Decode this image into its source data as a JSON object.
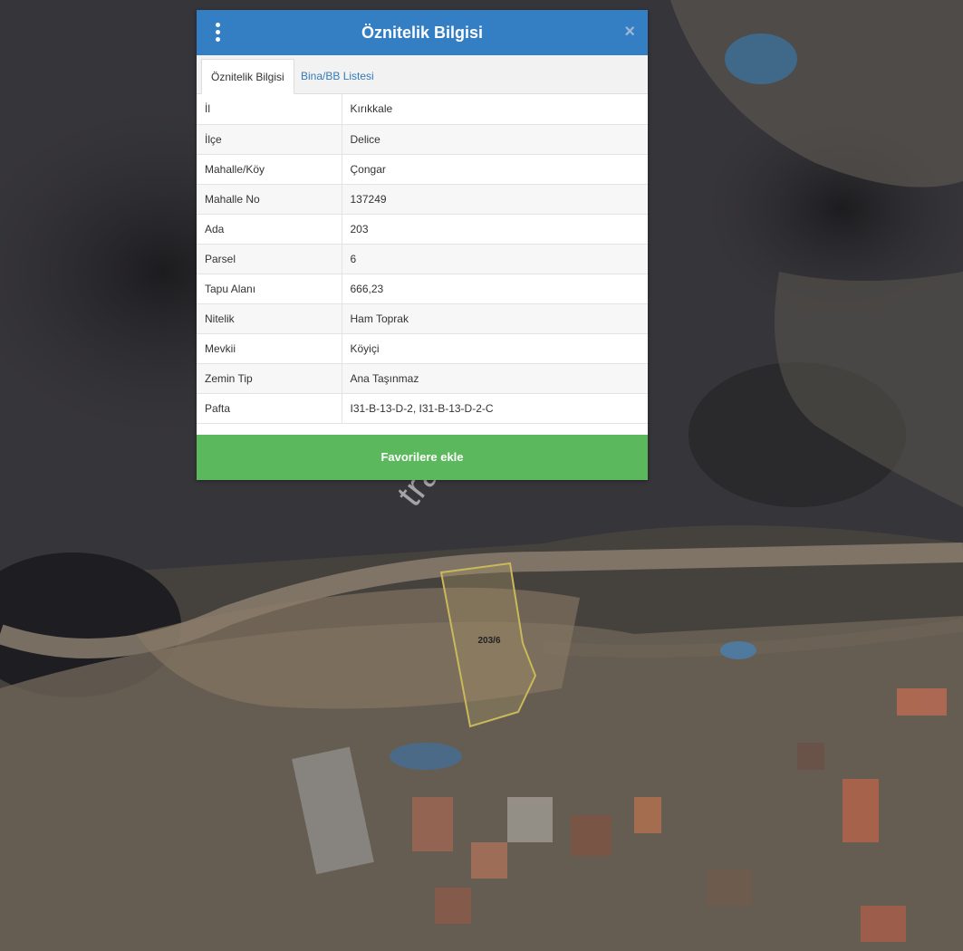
{
  "panel": {
    "title": "Öznitelik Bilgisi",
    "close_glyph": "×",
    "tabs": [
      {
        "label": "Öznitelik Bilgisi",
        "active": true
      },
      {
        "label": "Bina/BB Listesi",
        "active": false
      }
    ],
    "rows": [
      {
        "key": "İl",
        "value": "Kırıkkale"
      },
      {
        "key": "İlçe",
        "value": "Delice"
      },
      {
        "key": "Mahalle/Köy",
        "value": "Çongar"
      },
      {
        "key": "Mahalle No",
        "value": "137249"
      },
      {
        "key": "Ada",
        "value": "203"
      },
      {
        "key": "Parsel",
        "value": "6"
      },
      {
        "key": "Tapu Alanı",
        "value": "666,23"
      },
      {
        "key": "Nitelik",
        "value": "Ham Toprak"
      },
      {
        "key": "Mevkii",
        "value": "Köyiçi"
      },
      {
        "key": "Zemin Tip",
        "value": "Ana Taşınmaz"
      },
      {
        "key": "Pafta",
        "value": "I31-B-13-D-2, I31-B-13-D-2-C"
      }
    ],
    "favorite_label": "Favorilere ekle"
  },
  "map": {
    "parcel_label": "203/6",
    "watermark": "trarsa.com",
    "colors": {
      "header": "#347fc3",
      "favorite": "#5cb85c",
      "parcel_outline": "#c9b95a"
    }
  }
}
